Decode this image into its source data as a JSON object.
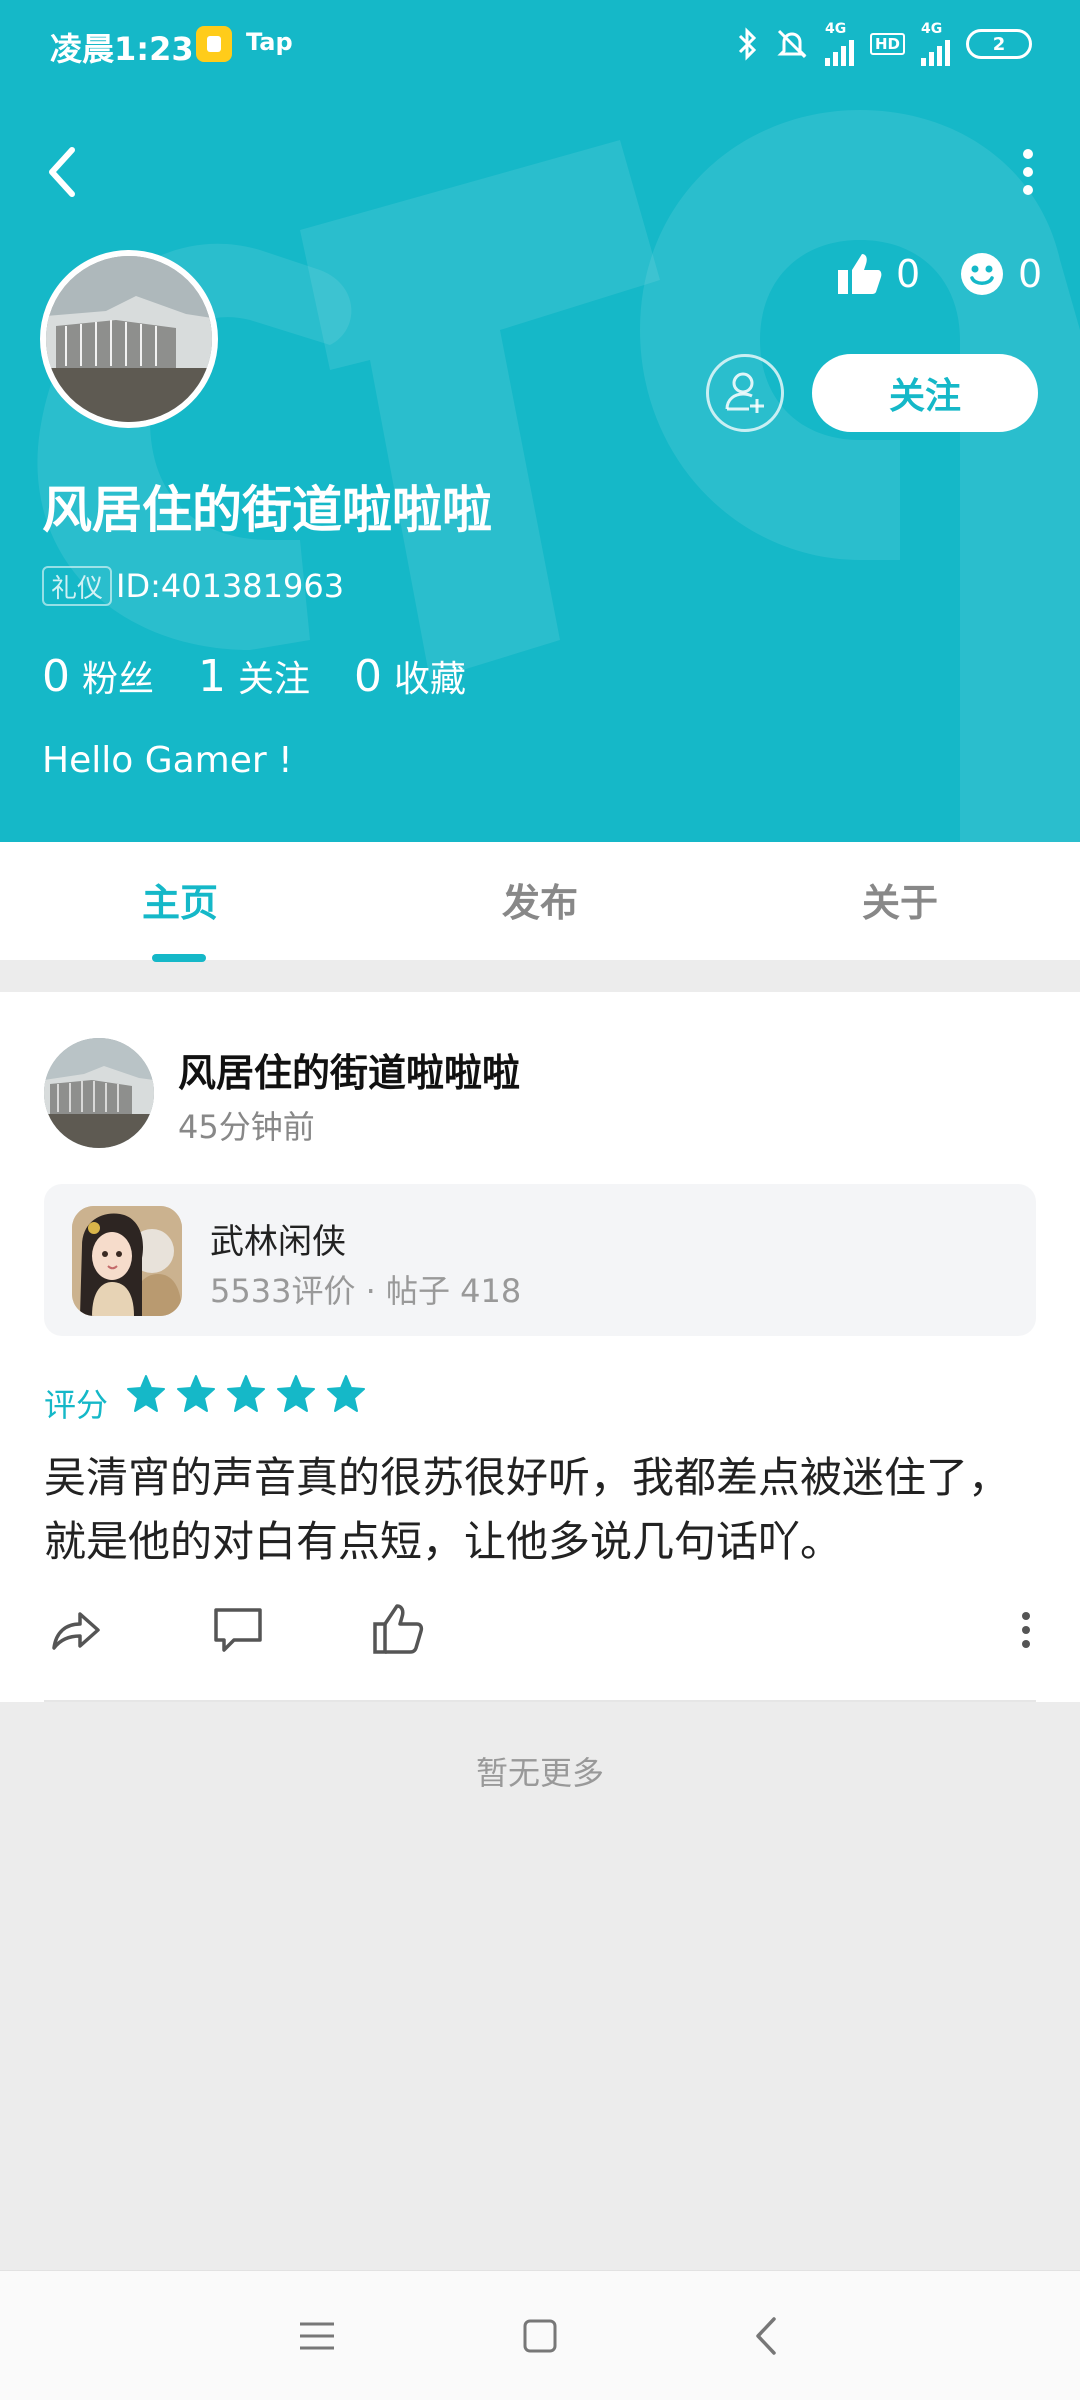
{
  "status_bar": {
    "time": "凌晨1:23",
    "app_label": "Tap",
    "network_1": "4G",
    "network_2": "4G",
    "hd": "HD",
    "battery": "2"
  },
  "header": {
    "like_count": "0",
    "smile_count": "0",
    "follow_label": "关注",
    "username": "风居住的街道啦啦啦",
    "tag": "礼仪",
    "user_id": "ID:401381963",
    "stats": [
      {
        "num": "0",
        "label": "粉丝"
      },
      {
        "num": "1",
        "label": "关注"
      },
      {
        "num": "0",
        "label": "收藏"
      }
    ],
    "bio": "Hello Gamer !"
  },
  "tabs": [
    {
      "label": "主页",
      "active": true
    },
    {
      "label": "发布",
      "active": false
    },
    {
      "label": "关于",
      "active": false
    }
  ],
  "post": {
    "username": "风居住的街道啦啦啦",
    "time": "45分钟前",
    "game": {
      "name": "武林闲侠",
      "meta": "5533评价 · 帖子 418"
    },
    "rating_label": "评分",
    "rating": 5,
    "review": "吴清宵的声音真的很苏很好听，我都差点被迷住了，就是他的对白有点短，让他多说几句话吖。"
  },
  "footer": {
    "no_more": "暂无更多"
  },
  "colors": {
    "accent": "#15b8c8",
    "background": "#ececec"
  }
}
